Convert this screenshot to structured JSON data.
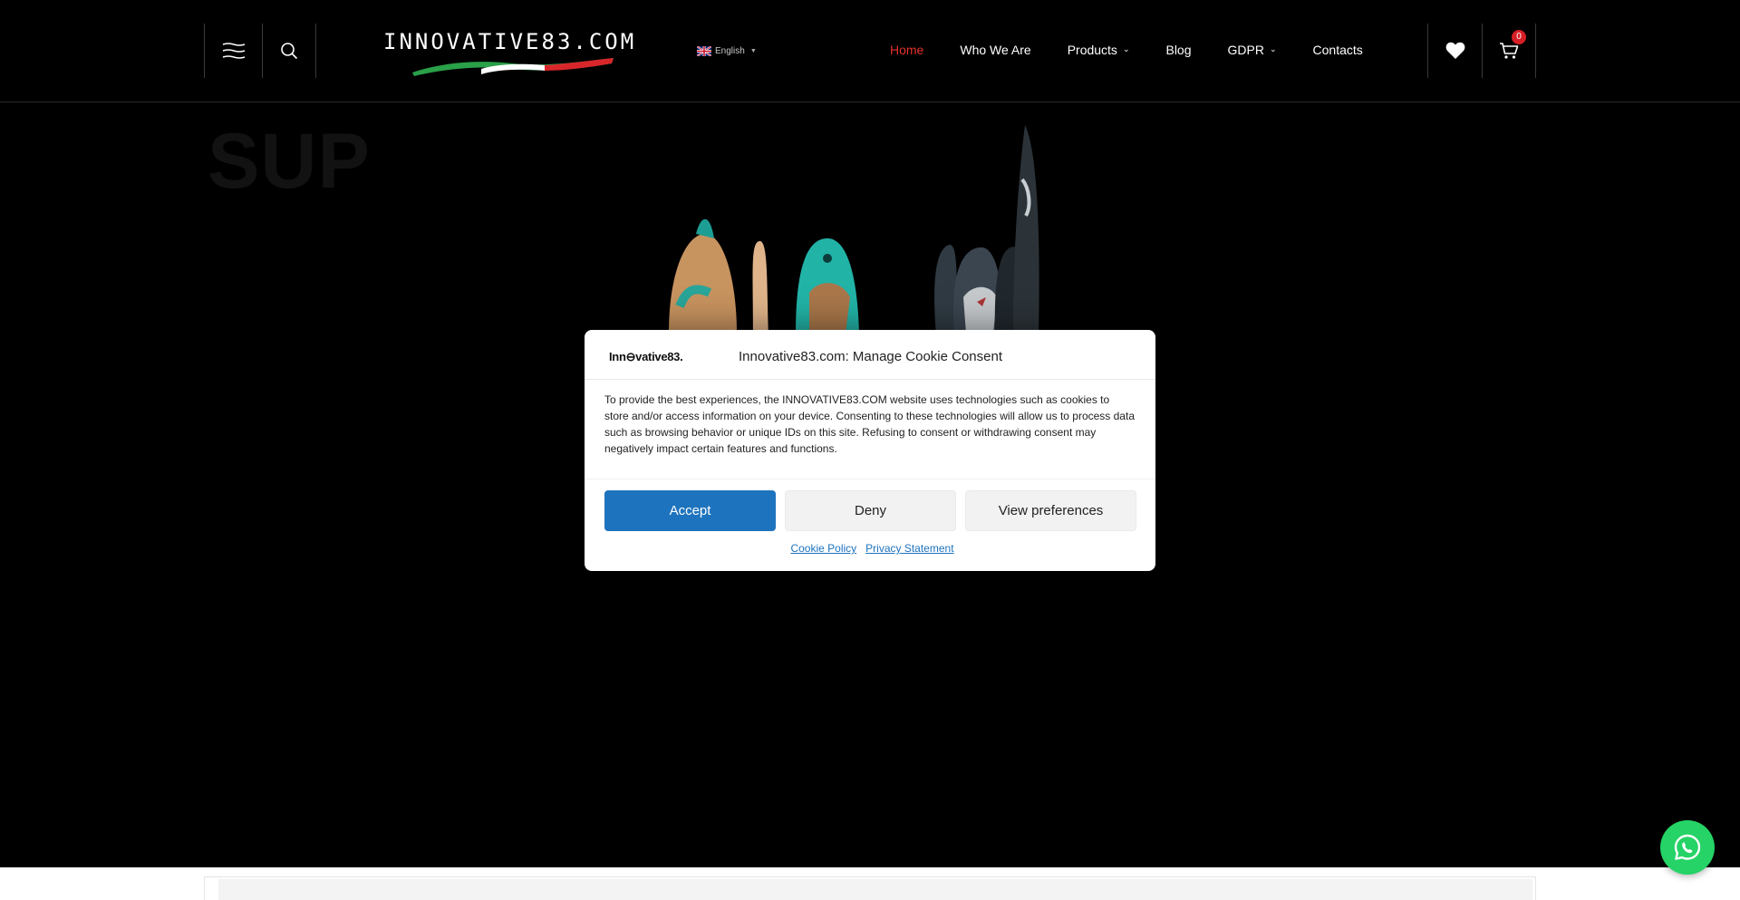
{
  "header": {
    "logo_text": "INNOVATIVE83.COM",
    "language": "English",
    "cart_count": "0",
    "nav": [
      {
        "label": "Home",
        "active": true
      },
      {
        "label": "Who We Are"
      },
      {
        "label": "Products",
        "has_dropdown": true
      },
      {
        "label": "Blog"
      },
      {
        "label": "GDPR",
        "has_dropdown": true
      },
      {
        "label": "Contacts"
      }
    ],
    "icons": [
      "menu-icon",
      "search-icon",
      "heart-icon",
      "cart-icon"
    ]
  },
  "hero": {
    "title": "SUP"
  },
  "cookie_modal": {
    "logo_text": "Inn⊖vative83.",
    "title": "Innovative83.com: Manage Cookie Consent",
    "body": "To provide the best experiences, the INNOVATIVE83.COM website uses technologies such as cookies to store and/or access information on your device. Consenting to these technologies will allow us to process data such as browsing behavior or unique IDs on this site. Refusing to consent or withdrawing consent may negatively impact certain features and functions.",
    "accept_label": "Accept",
    "deny_label": "Deny",
    "preferences_label": "View preferences",
    "cookie_policy_link": "Cookie Policy",
    "privacy_link": "Privacy Statement"
  },
  "colors": {
    "accent_red": "#e3322b",
    "accept_blue": "#1e73be",
    "whatsapp_green": "#25d366"
  }
}
